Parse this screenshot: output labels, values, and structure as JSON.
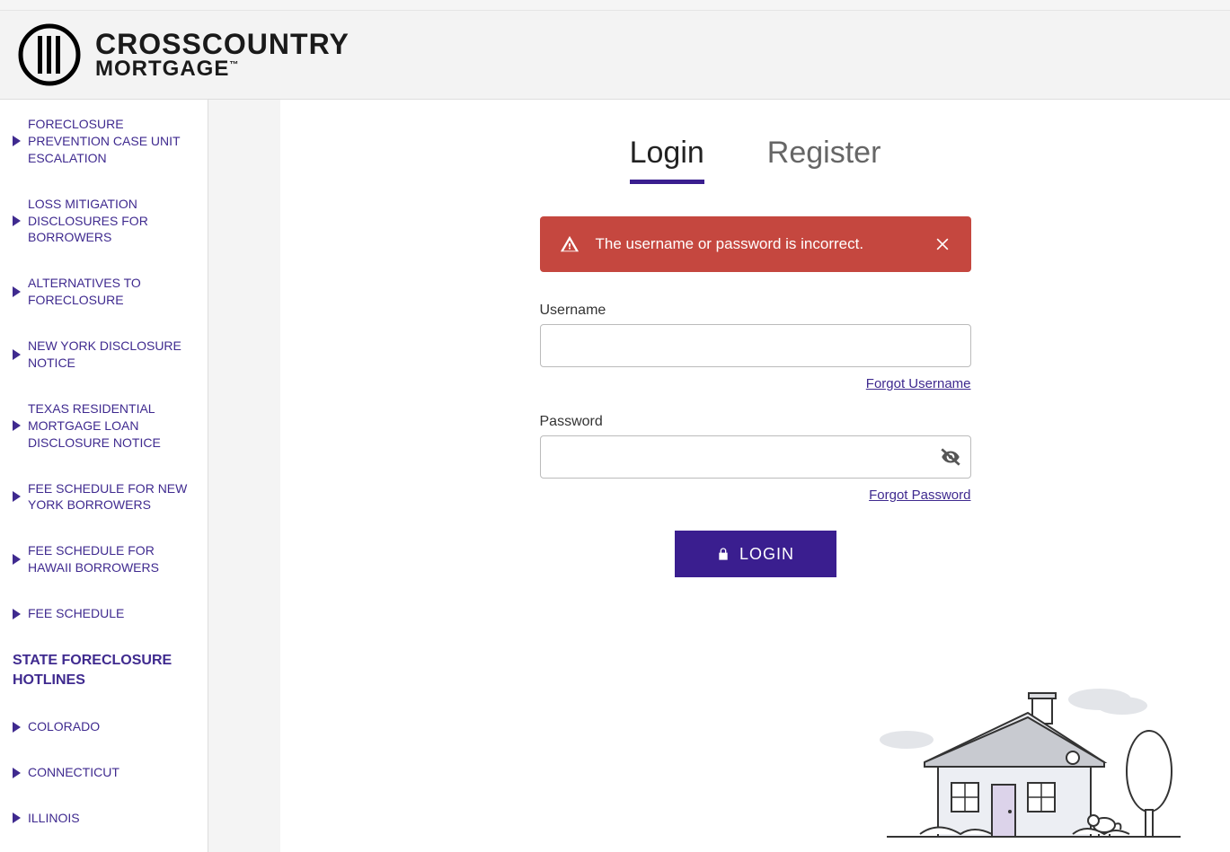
{
  "header": {
    "brand_line1": "CROSSCOUNTRY",
    "brand_line2": "MORTGAGE",
    "tm": "™"
  },
  "sidebar": {
    "items": [
      "FORECLOSURE PREVENTION CASE UNIT ESCALATION",
      "LOSS MITIGATION DISCLOSURES FOR BORROWERS",
      "ALTERNATIVES TO FORECLOSURE",
      "NEW YORK DISCLOSURE NOTICE",
      "TEXAS RESIDENTIAL MORTGAGE LOAN DISCLOSURE NOTICE",
      "FEE SCHEDULE FOR NEW YORK BORROWERS",
      "FEE SCHEDULE FOR HAWAII BORROWERS",
      "FEE SCHEDULE"
    ],
    "section_title": "STATE FORECLOSURE HOTLINES",
    "states": [
      "COLORADO",
      "CONNECTICUT",
      "ILLINOIS"
    ]
  },
  "tabs": {
    "login": "Login",
    "register": "Register"
  },
  "alert": {
    "message": "The username or password is incorrect."
  },
  "form": {
    "username_label": "Username",
    "forgot_username": "Forgot Username",
    "password_label": "Password",
    "forgot_password": "Forgot Password",
    "login_button": "LOGIN"
  },
  "colors": {
    "accent": "#3a1e8f",
    "error": "#c5473f"
  }
}
